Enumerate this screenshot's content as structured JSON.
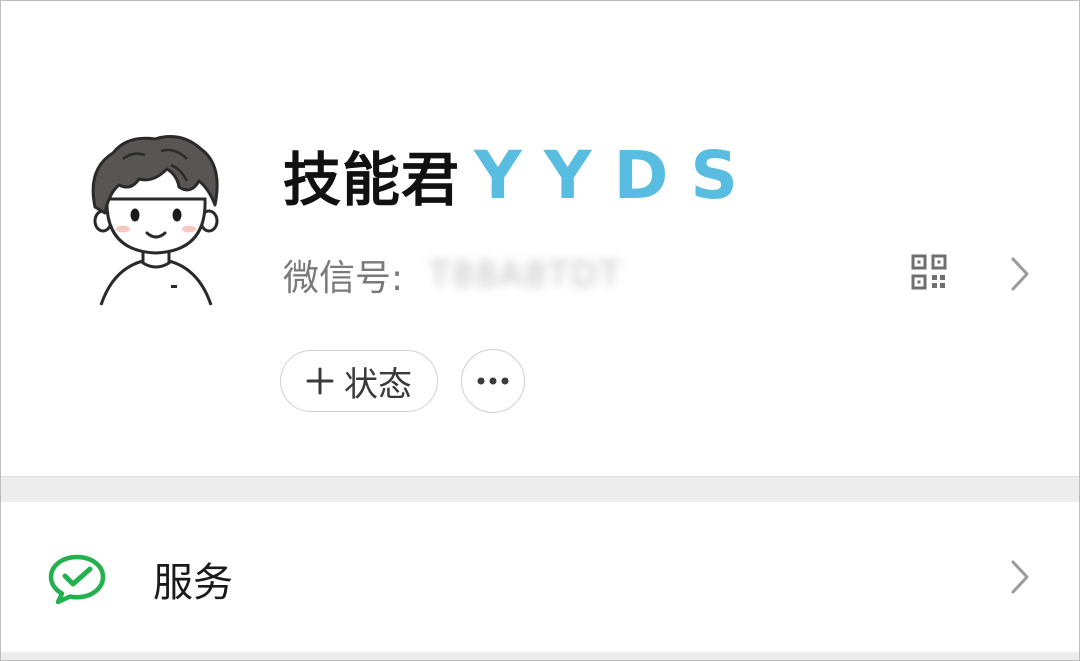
{
  "profile": {
    "name": "技能君",
    "name_suffix": "YYDS",
    "wechat_id_label": "微信号:",
    "wechat_id_value": "T88A8TDT",
    "status_button_label": "状态",
    "icons": {
      "avatar": "cartoon-boy-avatar",
      "qr": "qr-code-icon",
      "chevron": "chevron-right-icon",
      "plus": "plus-icon",
      "more": "more-dots-icon"
    }
  },
  "list": {
    "items": [
      {
        "label": "服务",
        "icon": "wechat-pay-icon"
      }
    ]
  },
  "colors": {
    "suffix_blue": "#58bde0",
    "wechat_green": "#22b14c",
    "separator_gray": "#ededed",
    "secondary_text": "#7a7a7a"
  }
}
